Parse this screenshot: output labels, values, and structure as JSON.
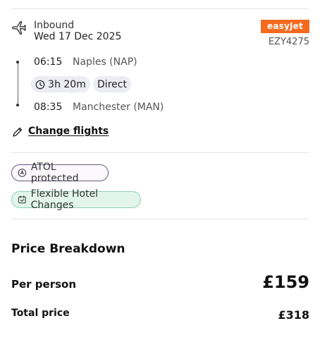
{
  "flight": {
    "direction_label": "Inbound",
    "date": "Wed 17 Dec 2025",
    "airline": {
      "name": "easyJet",
      "brand_color": "#f46a1e"
    },
    "flight_number": "EZY4275",
    "departure": {
      "time": "06:15",
      "place": "Naples (NAP)"
    },
    "duration": "3h 20m",
    "stops": "Direct",
    "arrival": {
      "time": "08:35",
      "place": "Manchester (MAN)"
    },
    "icons": {
      "plane": "plane-icon",
      "clock": "clock-icon"
    }
  },
  "change_flights": {
    "label": "Change flights",
    "icon": "pencil-icon"
  },
  "badges": {
    "atol": {
      "label": "ATOL protected",
      "icon": "atol-icon"
    },
    "flexible": {
      "label": "Flexible Hotel Changes",
      "icon": "calendar-check-icon",
      "color": "#e1f5ec"
    }
  },
  "price": {
    "title": "Price Breakdown",
    "per_person_label": "Per person",
    "per_person_value": "£159",
    "total_label": "Total price",
    "total_value": "£318"
  }
}
